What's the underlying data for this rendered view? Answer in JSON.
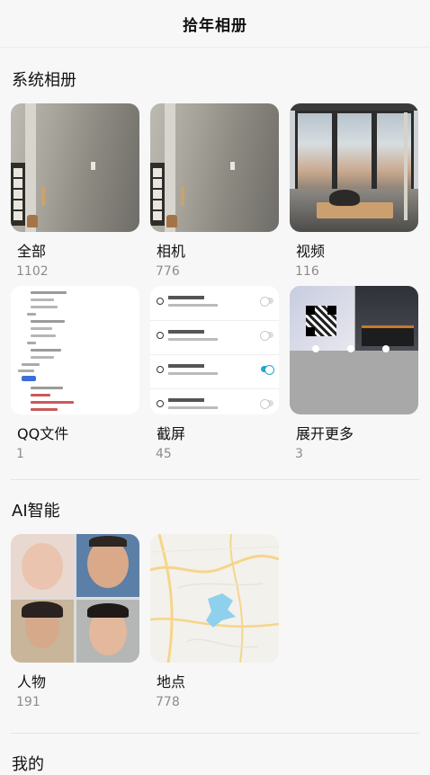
{
  "header": {
    "title": "拾年相册"
  },
  "system_albums": {
    "title": "系统相册",
    "items": [
      {
        "name": "全部",
        "count": "1102",
        "thumb": "room-photo"
      },
      {
        "name": "相机",
        "count": "776",
        "thumb": "room-photo"
      },
      {
        "name": "视频",
        "count": "116",
        "thumb": "window-view-photo"
      },
      {
        "name": "QQ文件",
        "count": "1",
        "thumb": "code-screenshot"
      },
      {
        "name": "截屏",
        "count": "45",
        "thumb": "settings-screenshot"
      },
      {
        "name": "展开更多",
        "count": "3",
        "thumb": "collage"
      }
    ]
  },
  "ai_albums": {
    "title": "AI智能",
    "items": [
      {
        "name": "人物",
        "count": "191",
        "thumb": "faces-collage"
      },
      {
        "name": "地点",
        "count": "778",
        "thumb": "map"
      }
    ]
  },
  "mine": {
    "title": "我的"
  },
  "colors": {
    "background": "#f7f7f7",
    "count_text": "#8c8c8c",
    "toggle_on": "#23a9c9"
  }
}
